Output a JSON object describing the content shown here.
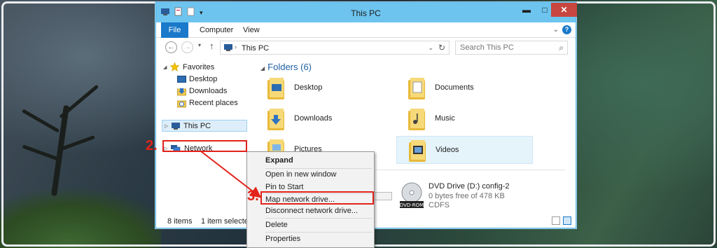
{
  "window": {
    "title": "This PC",
    "controls": {
      "minimize": "▬",
      "maximize": "□",
      "close": "✕"
    },
    "qat_dropdown": "▾"
  },
  "ribbon": {
    "tabs": [
      "File",
      "Computer",
      "View"
    ],
    "chevron": "⌄",
    "help": "?"
  },
  "navigation": {
    "back": "←",
    "forward": "→",
    "recent": "▾",
    "up": "↑",
    "address_path": "This PC",
    "address_separator": "›",
    "address_dropdown": "⌄",
    "refresh": "↻",
    "search_placeholder": "Search This PC",
    "search_icon": "⌕"
  },
  "sidebar": {
    "items": [
      {
        "label": "Favorites",
        "icon": "star-icon"
      },
      {
        "label": "Desktop",
        "icon": "desktop-icon"
      },
      {
        "label": "Downloads",
        "icon": "downloads-icon"
      },
      {
        "label": "Recent places",
        "icon": "recent-places-icon"
      },
      {
        "label": "This PC",
        "icon": "computer-icon"
      },
      {
        "label": "Network",
        "icon": "network-icon"
      }
    ]
  },
  "content": {
    "section_title": "Folders (6)",
    "folders": [
      {
        "name": "Desktop"
      },
      {
        "name": "Documents"
      },
      {
        "name": "Downloads"
      },
      {
        "name": "Music"
      },
      {
        "name": "Pictures"
      },
      {
        "name": "Videos"
      }
    ],
    "drive": {
      "name": "DVD Drive (D:) config-2",
      "free": "0 bytes free of 478 KB",
      "filesystem": "CDFS",
      "badge": "DVD-ROM"
    }
  },
  "status": {
    "items": "8 items",
    "selected": "1 item selected"
  },
  "context_menu": {
    "items": [
      {
        "label": "Expand"
      },
      {
        "label": "Open in new window"
      },
      {
        "label": "Pin to Start"
      },
      {
        "label": "Map network drive..."
      },
      {
        "label": "Disconnect network drive..."
      },
      {
        "label": "Delete"
      },
      {
        "label": "Properties"
      }
    ]
  },
  "annotations": {
    "step2": "2.",
    "step3": "3.",
    "color": "#e2231a"
  },
  "colors": {
    "titlebar": "#6cc4ef",
    "file_tab": "#1979ca",
    "close_button": "#c7463f",
    "folder": "#f2c94c"
  }
}
